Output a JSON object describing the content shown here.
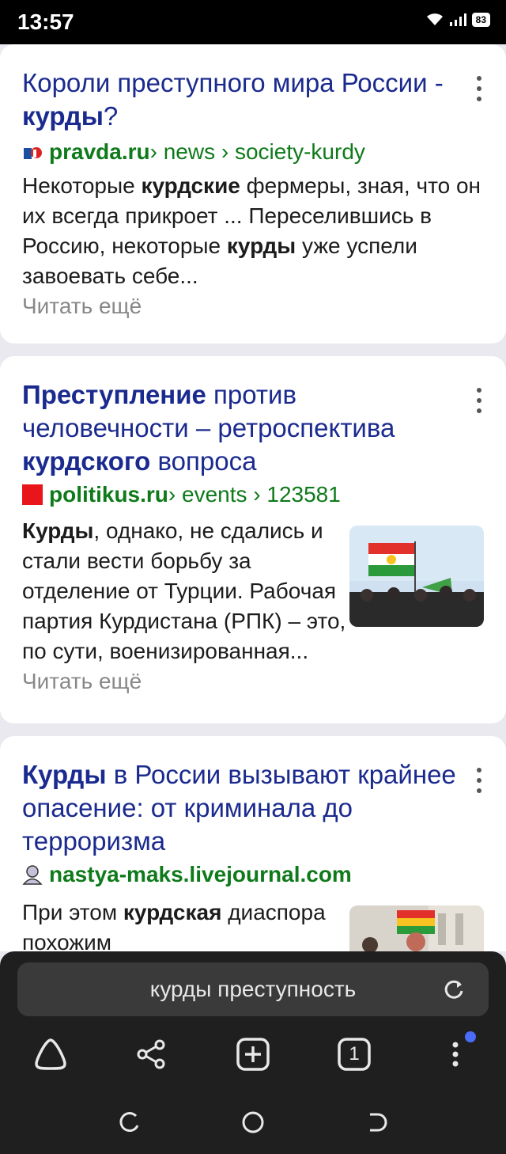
{
  "status_bar": {
    "time": "13:57",
    "battery": "83",
    "icons": [
      "wifi-icon",
      "signal-icon",
      "battery-icon"
    ]
  },
  "results": [
    {
      "title_parts": [
        "Короли преступного мира России - ",
        "курды",
        "?"
      ],
      "favicon": "pravda-favicon",
      "domain": "pravda.ru",
      "path": " › news › society-kurdy",
      "snippet_parts": [
        "Некоторые ",
        "курдские",
        " фермеры, зная, что он их всегда прикроет ... Переселившись в Россию, некоторые ",
        "курды",
        " уже успели завоевать себе..."
      ],
      "read_more": "Читать ещё"
    },
    {
      "title_parts": [
        "Преступление",
        " против человечности – ретроспектива ",
        "курдского",
        " вопроса"
      ],
      "favicon": "politikus-favicon",
      "domain": "politikus.ru",
      "path": " › events › 123581",
      "snippet_parts": [
        "Курды",
        ", однако, не сдались и стали вести борьбу за отделение от Турции. Рабочая партия Курдистана (РПК) – это, по сути, военизированная... "
      ],
      "read_more": "Читать ещё",
      "thumbnail": "kurdistan-flag-photo"
    },
    {
      "title_parts": [
        "Курды",
        " в России вызывают крайнее опасение: от криминала до терроризма"
      ],
      "favicon": "livejournal-user-favicon",
      "domain": "nastya-maks.livejournal.com",
      "path": "",
      "snippet_parts": [
        "При этом ",
        "курдская",
        " диаспора похожим"
      ],
      "thumbnail": "protest-photo"
    }
  ],
  "search": {
    "query": "курды преступность"
  },
  "toolbar": {
    "items": [
      "home-icon",
      "share-icon",
      "new-tab-icon",
      "tabs-counter-icon",
      "menu-icon"
    ],
    "tabs_count": "1"
  },
  "colors": {
    "title": "#1a2a8e",
    "url": "#0e7a1a",
    "read_more": "#888888",
    "bottom_bar": "#1f1f1f"
  }
}
